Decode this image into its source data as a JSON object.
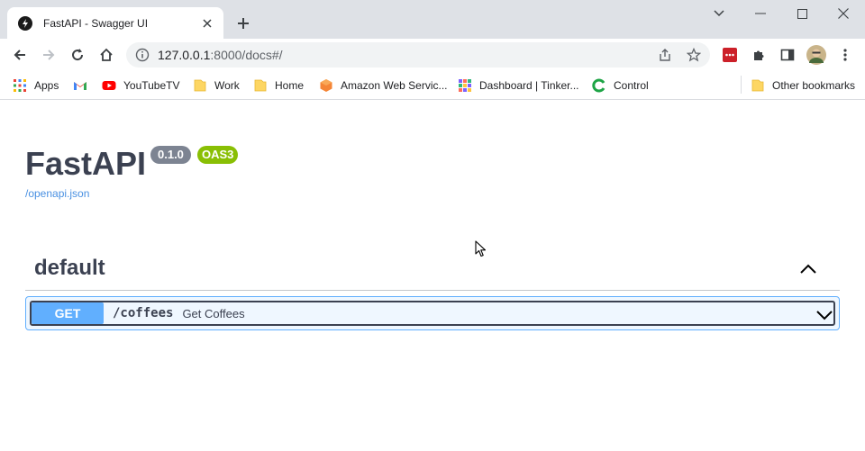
{
  "browser": {
    "tab": {
      "title": "FastAPI - Swagger UI"
    },
    "url": {
      "host": "127.0.0.1",
      "rest": ":8000/docs#/"
    },
    "bookmarks": [
      {
        "label": "Apps",
        "icon": "apps-grid-icon"
      },
      {
        "label": "",
        "icon": "gmail-icon"
      },
      {
        "label": "YouTubeTV",
        "icon": "youtube-icon"
      },
      {
        "label": "Work",
        "icon": "folder-icon"
      },
      {
        "label": "Home",
        "icon": "folder-icon"
      },
      {
        "label": "Amazon Web Servic...",
        "icon": "aws-icon"
      },
      {
        "label": "Dashboard | Tinker...",
        "icon": "tinker-icon"
      },
      {
        "label": "Control",
        "icon": "control-icon"
      }
    ],
    "other_bookmarks": "Other bookmarks"
  },
  "swagger": {
    "title": "FastAPI",
    "version": "0.1.0",
    "oas": "OAS3",
    "spec_link": "/openapi.json",
    "section": "default",
    "operations": [
      {
        "method": "GET",
        "path": "/coffees",
        "summary": "Get Coffees"
      }
    ]
  },
  "colors": {
    "get_method": "#61affe",
    "oas_badge": "#89bf04",
    "version_badge": "#7d8492",
    "text": "#3b4151",
    "link": "#4990e2"
  }
}
